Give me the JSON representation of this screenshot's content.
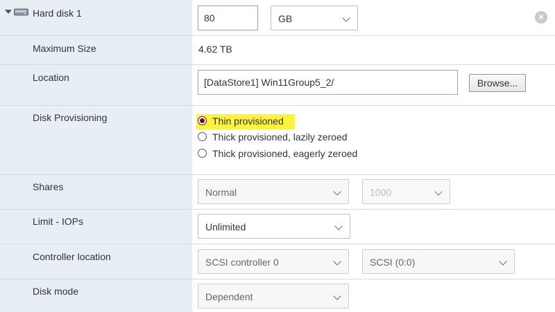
{
  "disk": {
    "title": "Hard disk 1",
    "size_value": "80",
    "size_unit": "GB"
  },
  "rows": {
    "max_size_label": "Maximum Size",
    "max_size_value": "4.62 TB",
    "location_label": "Location",
    "location_value": "[DataStore1] Win11Group5_2/",
    "browse_label": "Browse...",
    "provisioning_label": "Disk Provisioning",
    "provisioning_options": [
      "Thin provisioned",
      "Thick provisioned, lazily zeroed",
      "Thick provisioned, eagerly zeroed"
    ],
    "provisioning_selected": "Thin provisioned",
    "shares_label": "Shares",
    "shares_value": "Normal",
    "shares_number": "1000",
    "limit_label": "Limit - IOPs",
    "limit_value": "Unlimited",
    "controller_label": "Controller location",
    "controller_value": "SCSI controller 0",
    "controller_slot": "SCSI (0:0)",
    "mode_label": "Disk mode",
    "mode_value": "Dependent"
  },
  "colors": {
    "left_panel": "#e7eef4",
    "highlight": "#fbf33f",
    "radio_selected": "#6b0d0d"
  },
  "icons": [
    "caret-down-icon",
    "hard-disk-icon",
    "remove-circle-icon",
    "chevron-down-icon"
  ]
}
